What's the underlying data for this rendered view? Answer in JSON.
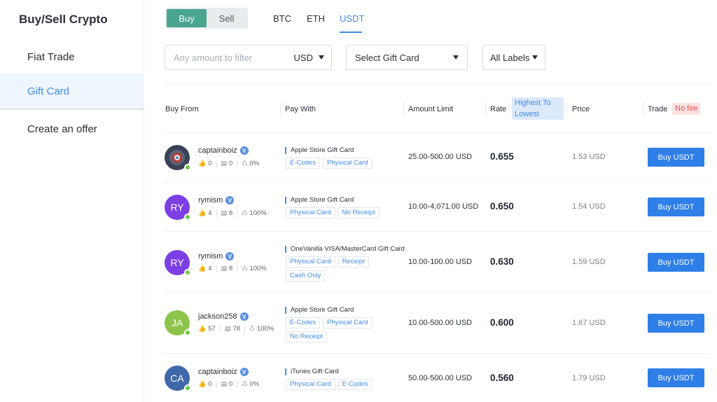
{
  "sidebar": {
    "title": "Buy/Sell Crypto",
    "items": [
      {
        "label": "Fiat Trade"
      },
      {
        "label": "Gift Card"
      },
      {
        "label": "Create an offer"
      }
    ]
  },
  "toggle": {
    "buy": "Buy",
    "sell": "Sell"
  },
  "coin_tabs": [
    "BTC",
    "ETH",
    "USDT"
  ],
  "filters": {
    "amount_placeholder": "Any amount to filter",
    "currency": "USD",
    "gift_card": "Select Gift Card",
    "labels": "All Labels"
  },
  "table": {
    "headers": {
      "buy_from": "Buy From",
      "pay_with": "Pay With",
      "amount_limit": "Amount Limit",
      "rate": "Rate",
      "sort": "Highest To Lowest",
      "price": "Price",
      "trade": "Trade",
      "no_fee": "No fee"
    },
    "rows": [
      {
        "avatar_text": "",
        "avatar_color": "#3a4256",
        "username": "captainboiz",
        "likes": "0",
        "trades": "0",
        "rate_pct": "0%",
        "card": "Apple Store Gift Card",
        "tags": [
          "E-Codes",
          "Physical Card"
        ],
        "limit": "25.00-500.00 USD",
        "rate": "0.655",
        "price": "1.53 USD",
        "buy_label": "Buy  USDT"
      },
      {
        "avatar_text": "RY",
        "avatar_color": "#7b3fe4",
        "username": "rymism",
        "likes": "4",
        "trades": "8",
        "rate_pct": "100%",
        "card": "Apple Store Gift Card",
        "tags": [
          "Physical Card",
          "No Receipt"
        ],
        "limit": "10.00-4,071.00 USD",
        "rate": "0.650",
        "price": "1.54 USD",
        "buy_label": "Buy  USDT"
      },
      {
        "avatar_text": "RY",
        "avatar_color": "#7b3fe4",
        "username": "rymism",
        "likes": "4",
        "trades": "8",
        "rate_pct": "100%",
        "card": "OneVanilla VISA/MasterCard Gift Card",
        "tags": [
          "Physical Card",
          "Receipt",
          "Cash Only"
        ],
        "limit": "10.00-100.00 USD",
        "rate": "0.630",
        "price": "1.59 USD",
        "buy_label": "Buy  USDT"
      },
      {
        "avatar_text": "JA",
        "avatar_color": "#8cc34b",
        "username": "jackson258",
        "likes": "57",
        "trades": "78",
        "rate_pct": "100%",
        "card": "Apple Store Gift Card",
        "tags": [
          "E-Codes",
          "Physical Card",
          "No Receipt"
        ],
        "limit": "10.00-500.00 USD",
        "rate": "0.600",
        "price": "1.67 USD",
        "buy_label": "Buy  USDT"
      },
      {
        "avatar_text": "CA",
        "avatar_color": "#3f68a8",
        "username": "captainboiz",
        "likes": "0",
        "trades": "0",
        "rate_pct": "0%",
        "card": "iTunes Gift Card",
        "tags": [
          "Physical Card",
          "E-Codes"
        ],
        "limit": "50.00-500.00 USD",
        "rate": "0.560",
        "price": "1.79 USD",
        "buy_label": "Buy  USDT"
      }
    ]
  },
  "colors": {
    "accent_blue": "#3d8ee8",
    "buy_green": "#4aa58f",
    "button_blue": "#2f7fe8",
    "online_green": "#6cc84a",
    "no_fee_red": "#e65050"
  }
}
